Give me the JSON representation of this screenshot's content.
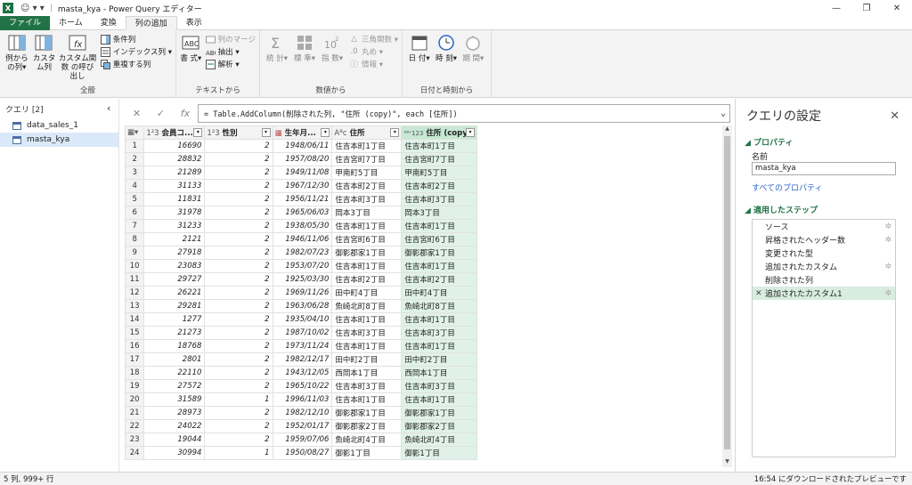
{
  "titlebar": {
    "app_icon": "X",
    "quick_access": "☺ ▾ ▾",
    "title": "masta_kya - Power Query エディター",
    "minimize": "—",
    "restore": "❐",
    "close": "✕"
  },
  "tabs": [
    "ファイル",
    "ホーム",
    "変換",
    "列の追加",
    "表示"
  ],
  "ribbon": {
    "general": {
      "label": "全般",
      "btn1": "例から の列▾",
      "btn2": "カスタ ム列",
      "btn3": "カスタム関数 の呼び出し",
      "small1": "条件列",
      "small2": "インデックス列 ▾",
      "small3": "重複する列"
    },
    "text": {
      "label": "テキストから",
      "big": "書 式▾",
      "small1": "列のマージ",
      "small2": "抽出 ▾",
      "small3": "解析 ▾"
    },
    "number": {
      "label": "数値から",
      "btn1": "統 計▾",
      "btn2": "標 準▾",
      "btn3": "指 数▾",
      "small1": "三角関数 ▾",
      "small2": "丸め ▾",
      "small3": "情報 ▾"
    },
    "datetime": {
      "label": "日付と時刻から",
      "btn1": "日 付▾",
      "btn2": "時 刻▾",
      "btn3": "期 間▾"
    }
  },
  "queries": {
    "header": "クエリ [2]",
    "chevron": "‹",
    "items": [
      "data_sales_1",
      "masta_kya"
    ]
  },
  "formula": {
    "cancel": "✕",
    "confirm": "✓",
    "fx": "fx",
    "text": "= Table.AddColumn(削除された列, \"住所 (copy)\", each [住所])",
    "expand": "⌄"
  },
  "grid": {
    "columns": [
      {
        "type": "1²3",
        "name": "会員コ..."
      },
      {
        "type": "1²3",
        "name": "性別"
      },
      {
        "type": "▦",
        "name": "生年月..."
      },
      {
        "type": "Aᴮc",
        "name": "住所"
      },
      {
        "type": "ᴬᴮᶜ123",
        "name": "住所 (copy)"
      }
    ],
    "rows": [
      [
        "1",
        "16690",
        "2",
        "1948/06/11",
        "住吉本町1丁目",
        "住吉本町1丁目"
      ],
      [
        "2",
        "28832",
        "2",
        "1957/08/20",
        "住吉宮町7丁目",
        "住吉宮町7丁目"
      ],
      [
        "3",
        "21289",
        "2",
        "1949/11/08",
        "甲南町5丁目",
        "甲南町5丁目"
      ],
      [
        "4",
        "31133",
        "2",
        "1967/12/30",
        "住吉本町2丁目",
        "住吉本町2丁目"
      ],
      [
        "5",
        "11831",
        "2",
        "1956/11/21",
        "住吉本町3丁目",
        "住吉本町3丁目"
      ],
      [
        "6",
        "31978",
        "2",
        "1965/06/03",
        "岡本3丁目",
        "岡本3丁目"
      ],
      [
        "7",
        "31233",
        "2",
        "1938/05/30",
        "住吉本町1丁目",
        "住吉本町1丁目"
      ],
      [
        "8",
        "2121",
        "2",
        "1946/11/06",
        "住吉宮町6丁目",
        "住吉宮町6丁目"
      ],
      [
        "9",
        "27918",
        "2",
        "1982/07/23",
        "御影郡家1丁目",
        "御影郡家1丁目"
      ],
      [
        "10",
        "23083",
        "2",
        "1953/07/20",
        "住吉本町1丁目",
        "住吉本町1丁目"
      ],
      [
        "11",
        "29727",
        "2",
        "1925/03/30",
        "住吉本町2丁目",
        "住吉本町2丁目"
      ],
      [
        "12",
        "26221",
        "2",
        "1969/11/26",
        "田中町4丁目",
        "田中町4丁目"
      ],
      [
        "13",
        "29281",
        "2",
        "1963/06/28",
        "魚崎北町8丁目",
        "魚崎北町8丁目"
      ],
      [
        "14",
        "1277",
        "2",
        "1935/04/10",
        "住吉本町1丁目",
        "住吉本町1丁目"
      ],
      [
        "15",
        "21273",
        "2",
        "1987/10/02",
        "住吉本町3丁目",
        "住吉本町3丁目"
      ],
      [
        "16",
        "18768",
        "2",
        "1973/11/24",
        "住吉本町1丁目",
        "住吉本町1丁目"
      ],
      [
        "17",
        "2801",
        "2",
        "1982/12/17",
        "田中町2丁目",
        "田中町2丁目"
      ],
      [
        "18",
        "22110",
        "2",
        "1943/12/05",
        "西岡本1丁目",
        "西岡本1丁目"
      ],
      [
        "19",
        "27572",
        "2",
        "1965/10/22",
        "住吉本町3丁目",
        "住吉本町3丁目"
      ],
      [
        "20",
        "31589",
        "1",
        "1996/11/03",
        "住吉本町1丁目",
        "住吉本町1丁目"
      ],
      [
        "21",
        "28973",
        "2",
        "1982/12/10",
        "御影郡家1丁目",
        "御影郡家1丁目"
      ],
      [
        "22",
        "24022",
        "2",
        "1952/01/17",
        "御影郡家2丁目",
        "御影郡家2丁目"
      ],
      [
        "23",
        "19044",
        "2",
        "1959/07/06",
        "魚崎北町4丁目",
        "魚崎北町4丁目"
      ],
      [
        "24",
        "30994",
        "1",
        "1950/08/27",
        "御影1丁目",
        "御影1丁目"
      ]
    ]
  },
  "settings": {
    "title": "クエリの設定",
    "close": "✕",
    "properties_header": "◢ プロパティ",
    "name_label": "名前",
    "name_value": "masta_kya",
    "all_props": "すべてのプロパティ",
    "steps_header": "◢ 適用したステップ",
    "steps": [
      "ソース",
      "昇格されたヘッダー数",
      "変更された型",
      "追加されたカスタム",
      "削除された列",
      "追加されたカスタム1"
    ]
  },
  "status": {
    "left": "5 列, 999+ 行",
    "right": "16:54 にダウンロードされたプレビューです"
  }
}
